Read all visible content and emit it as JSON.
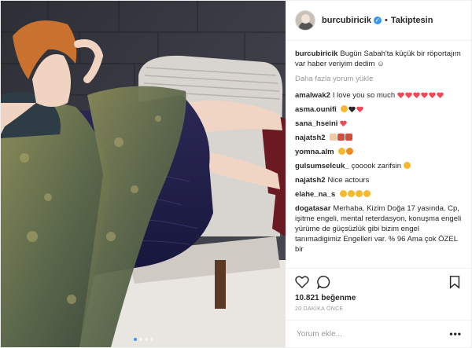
{
  "header": {
    "username": "burcubiricik",
    "follow_status": "Takiptesin",
    "separator": "•"
  },
  "caption": {
    "username": "burcubiricik",
    "text": "Bugün Sabah'ta küçük bir röportajım var haber veriyim dedim ☺"
  },
  "load_more": "Daha fazla yorum yükle",
  "comments": [
    {
      "user": "amalwak2",
      "text": "I love you so much"
    },
    {
      "user": "asma.ounifi",
      "text": ""
    },
    {
      "user": "sana_hseini",
      "text": ""
    },
    {
      "user": "najatsh2",
      "text": ""
    },
    {
      "user": "yomna.alm",
      "text": ""
    },
    {
      "user": "gulsumselcuk_",
      "text": "çooook zarifsin"
    },
    {
      "user": "najatsh2",
      "text": "Nice actours"
    },
    {
      "user": "elahe_na_s",
      "text": ""
    },
    {
      "user": "dogatasar",
      "text": "Merhaba. Kizim Doğa 17 yasında. Cp, işitme engeli, mental reterdasyon, konuşma engeli yürüme de güçsüzlük gibi bizim engel tanımadigimiz Engelleri var. % 96 Ama çok ÖZEL bir"
    }
  ],
  "likes": "10.821 beğenme",
  "time_ago": "20 DAKİKA ÖNCE",
  "comment_input": {
    "placeholder": "Yorum ekle..."
  },
  "more_options": "•••",
  "colors": {
    "link_blue": "#3897f0",
    "heart_red": "#ed4956",
    "muted": "#999999"
  }
}
